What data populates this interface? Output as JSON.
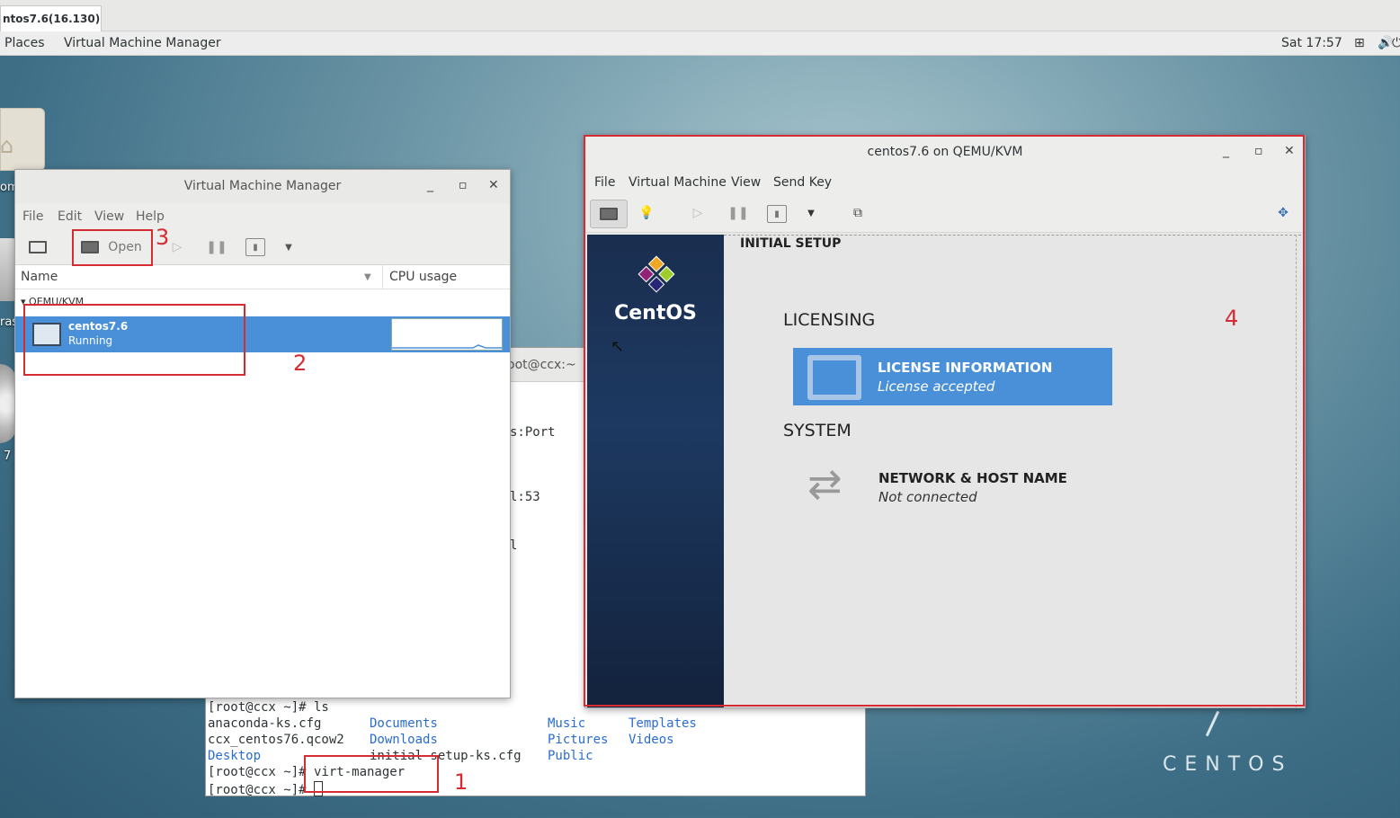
{
  "tab": {
    "label": "ntos7.6(16.130)"
  },
  "topbar": {
    "places": "Places",
    "app": "Virtual Machine Manager",
    "clock": "Sat 17:57"
  },
  "desktop": {
    "left_labels": [
      "om",
      "ras",
      "7"
    ],
    "watermark": "CENTOS"
  },
  "terminal": {
    "title": "oot@ccx:~",
    "behind_lines": [
      "s:Port",
      "l:53",
      "l"
    ],
    "prompt_ls": "[root@ccx ~]# ls",
    "files_col1": [
      "anaconda-ks.cfg",
      "ccx_centos76.qcow2",
      "Desktop"
    ],
    "files_col2": [
      "Documents",
      "Downloads",
      "initial-setup-ks.cfg"
    ],
    "files_col3": [
      "Music",
      "Pictures",
      "Public"
    ],
    "files_col4": [
      "Templates",
      "Videos"
    ],
    "prompt_virt": "[root@ccx ~]# virt-manager",
    "prompt_last": "[root@ccx ~]# "
  },
  "vmm": {
    "title": "Virtual Machine Manager",
    "menu": [
      "File",
      "Edit",
      "View",
      "Help"
    ],
    "open_label": "Open",
    "columns": {
      "name": "Name",
      "cpu": "CPU usage"
    },
    "group": "QEMU/KVM",
    "vm": {
      "name": "centos7.6",
      "status": "Running"
    }
  },
  "viewer": {
    "title": "centos7.6 on QEMU/KVM",
    "menu": [
      "File",
      "Virtual Machine",
      "View",
      "Send Key"
    ],
    "guest": {
      "brand": "CentOS",
      "header": "INITIAL SETUP",
      "licensing": "LICENSING",
      "license_title": "LICENSE INFORMATION",
      "license_status": "License accepted",
      "system": "SYSTEM",
      "network_title": "NETWORK & HOST NAME",
      "network_status": "Not connected"
    }
  },
  "annotations": {
    "n1": "1",
    "n2": "2",
    "n3": "3",
    "n4": "4"
  },
  "colors": {
    "selection": "#4a90d9",
    "annotation": "#d62b32",
    "centos_panel": "#1d3961"
  }
}
